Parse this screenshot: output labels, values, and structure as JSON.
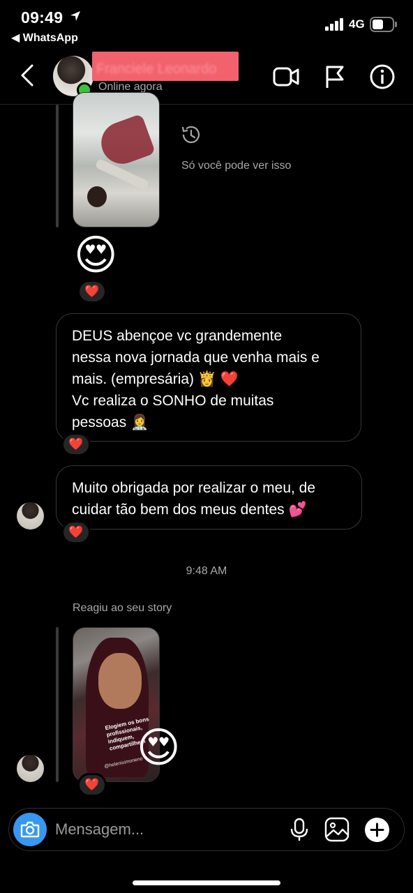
{
  "status_bar": {
    "time": "09:49",
    "back_app": "◀ WhatsApp",
    "network": "4G",
    "location_icon": "location-arrow-icon",
    "signal_icon": "signal-bars-icon",
    "battery_icon": "battery-icon"
  },
  "header": {
    "contact_name": "Franciele Leonardo",
    "status": "Online agora",
    "icons": [
      "back-chevron-icon",
      "video-call-icon",
      "flag-icon",
      "info-icon"
    ],
    "name_redaction_color": "#f2626e",
    "online_color": "#3cc13b"
  },
  "messages": {
    "story1_note": "Só você pode ver isso",
    "story1_emoji": "😍",
    "story1_reaction": "❤️",
    "bubble1": {
      "line1": "DEUS abençoe vc grandemente",
      "line2": "nessa nova jornada que venha mais e",
      "line3": "mais. (empresária) 👸 ❤️",
      "line4": "Vc realiza o SONHO de muitas",
      "line5": "pessoas 👩‍⚕️",
      "reaction": "❤️"
    },
    "bubble2": {
      "line1": "Muito obrigada por realizar o meu, de",
      "line2": "cuidar tão bem dos meus dentes 💕",
      "reaction": "❤️"
    },
    "timestamp": "9:48 AM",
    "reacted_label": "Reagiu ao seu story",
    "story2_caption": "Elogiem os bons profissionais, indiquem, compartilhem",
    "story2_handle": "@helenisimoneno",
    "story2_emoji": "😍",
    "story2_reaction": "❤️"
  },
  "composer": {
    "placeholder": "Mensagem...",
    "icons": [
      "camera-icon",
      "microphone-icon",
      "gallery-icon",
      "plus-icon"
    ],
    "camera_color": "#3897f0"
  }
}
